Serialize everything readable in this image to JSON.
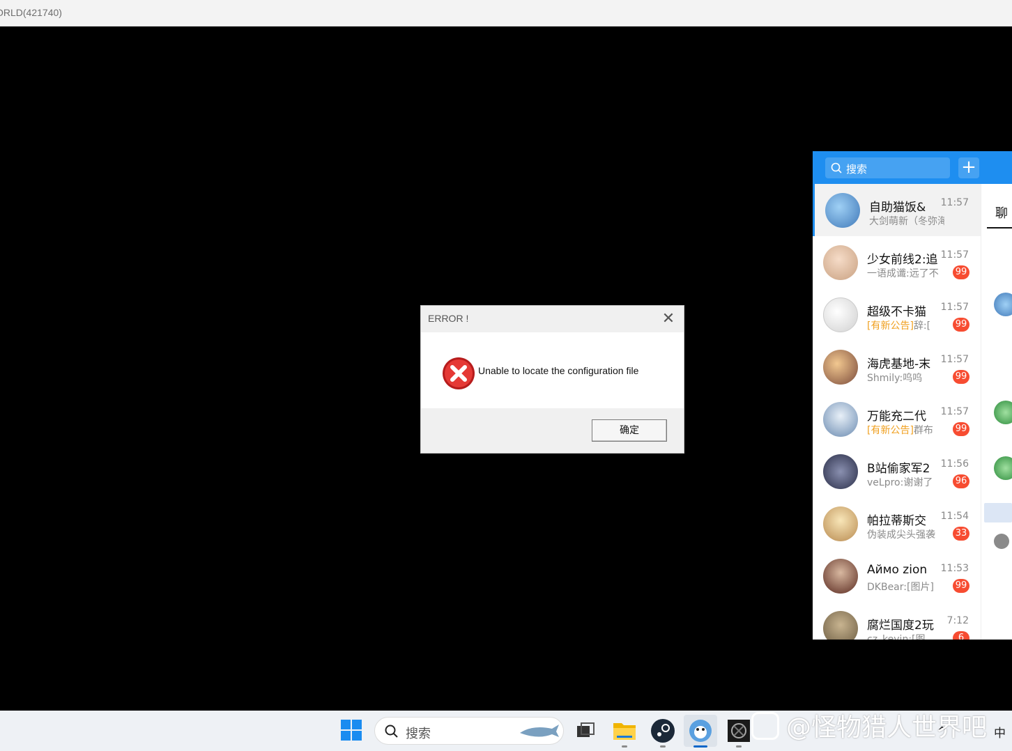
{
  "window": {
    "title": "ORLD(421740)"
  },
  "dialog": {
    "title": "ERROR !",
    "close_glyph": "✕",
    "message": "Unable to locate the configuration file",
    "ok_label": "确定"
  },
  "qq": {
    "search_placeholder": "搜索",
    "add_glyph": "+",
    "side_tab": "聊",
    "chats": [
      {
        "name": "自助猫饭&",
        "time": "11:57",
        "notice": "",
        "preview": "大剑萌新（冬弥海潮",
        "badge": ""
      },
      {
        "name": "少女前线2:追",
        "time": "11:57",
        "notice": "",
        "preview": "一语成谶:远了不",
        "badge": "99"
      },
      {
        "name": "超级不卡猫",
        "time": "11:57",
        "notice": "[有新公告]",
        "preview": "辞:[",
        "badge": "99"
      },
      {
        "name": "海虎基地-末",
        "time": "11:57",
        "notice": "",
        "preview": "Shmily:呜呜",
        "badge": "99"
      },
      {
        "name": "万能充二代",
        "time": "11:57",
        "notice": "[有新公告]",
        "preview": "群布",
        "badge": "99"
      },
      {
        "name": "B站偷家军2",
        "time": "11:56",
        "notice": "",
        "preview": "veLpro:谢谢了",
        "badge": "96"
      },
      {
        "name": "帕拉蒂斯交",
        "time": "11:54",
        "notice": "",
        "preview": "伪装成尖头强袭",
        "badge": "33"
      },
      {
        "name": "Аймо zion",
        "time": "11:53",
        "notice": "",
        "preview": "DKBear:[图片]",
        "badge": "99"
      },
      {
        "name": "腐烂国度2玩",
        "time": "7:12",
        "notice": "",
        "preview": "cz_kevin:[图",
        "badge": "6"
      }
    ]
  },
  "taskbar": {
    "search_placeholder": "搜索",
    "apps": [
      "task-view-icon",
      "file-explorer-icon",
      "steam-icon",
      "qq-icon",
      "game-icon"
    ]
  },
  "watermark": "@怪物猎人世界吧",
  "tray": {
    "ime": "中",
    "chevron": "^"
  },
  "colors": {
    "qq_blue": "#1e8ef0",
    "badge_red": "#f74c31",
    "notice_orange": "#f0a020"
  }
}
